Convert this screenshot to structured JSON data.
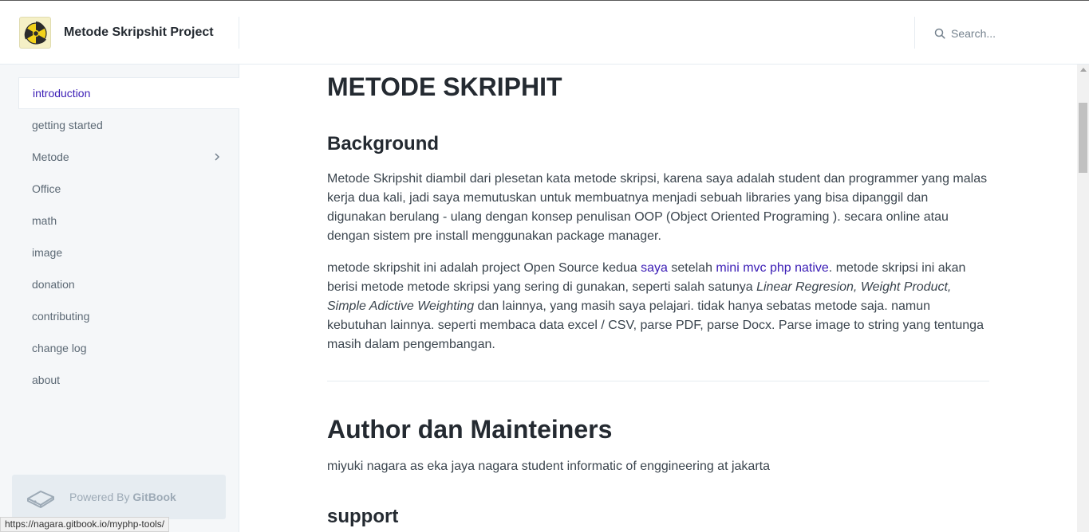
{
  "header": {
    "site_title": "Metode Skripshit Project",
    "logo_icon": "radiation-icon",
    "search_placeholder": "Search..."
  },
  "sidebar": {
    "items": [
      {
        "label": "introduction",
        "active": true
      },
      {
        "label": "getting started"
      },
      {
        "label": "Metode",
        "has_children": true
      },
      {
        "label": "Office"
      },
      {
        "label": "math"
      },
      {
        "label": "image"
      },
      {
        "label": "donation"
      },
      {
        "label": "contributing"
      },
      {
        "label": "change log"
      },
      {
        "label": "about"
      }
    ],
    "powered_by_prefix": "Powered By ",
    "powered_by_brand": "GitBook"
  },
  "status_bar": {
    "url": "https://nagara.gitbook.io/myphp-tools/"
  },
  "main": {
    "title": "METODE SKRIPHIT",
    "background_heading": "Background",
    "background_text": "Metode Skripshit diambil dari plesetan kata metode skripsi, karena saya adalah student dan programmer yang malas kerja dua kali, jadi saya memutuskan untuk membuatnya menjadi sebuah libraries yang bisa dipanggil dan digunakan berulang - ulang dengan konsep penulisan OOP (Object Oriented  Programing ). secara online atau dengan sistem pre install menggunakan package manager.",
    "p2_part1": "metode skripshit ini adalah project Open Source kedua ",
    "p2_link1": "saya",
    "p2_part2": " setelah ",
    "p2_link2": "mini mvc php native",
    "p2_part3": ". metode skripsi ini akan berisi metode metode skripsi yang sering di gunakan, seperti salah satunya ",
    "p2_italic": "Linear Regresion, Weight Product, Simple Adictive Weighting",
    "p2_part4": "  dan lainnya, yang masih saya pelajari. tidak hanya sebatas metode saja. namun kebutuhan lainnya. seperti membaca data excel / CSV, parse PDF, parse Docx. Parse image to string yang tentunga masih dalam pengembangan.",
    "author_heading": "Author dan Mainteiners",
    "author_text": "miyuki nagara as eka jaya nagara student informatic of enggineering at jakarta",
    "support_heading": "support"
  },
  "colors": {
    "accent": "#3a1cb5",
    "sidebar_bg": "#f5f7f9",
    "heading": "#242a31",
    "text": "#3b454e"
  }
}
